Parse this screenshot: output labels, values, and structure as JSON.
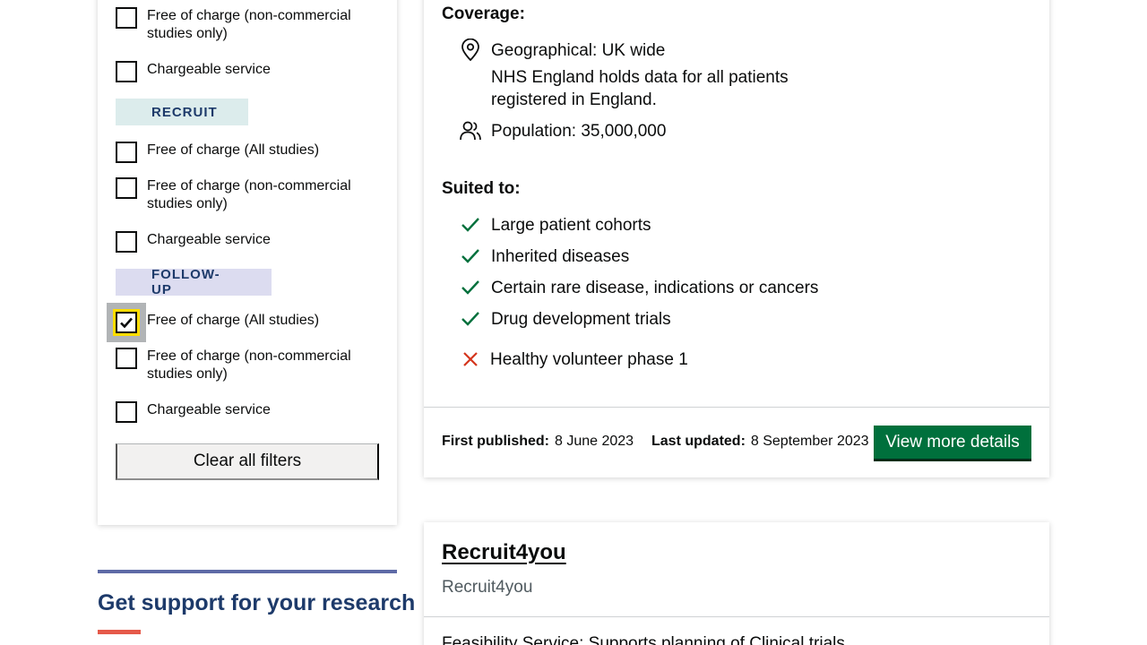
{
  "filters": {
    "top_items": [
      {
        "label": "Free of charge (non-commercial studies only)",
        "checked": false
      },
      {
        "label": "Chargeable service",
        "checked": false
      }
    ],
    "recruit": {
      "tag": "RECRUIT",
      "items": [
        {
          "label": "Free of charge (All studies)",
          "checked": false
        },
        {
          "label": "Free of charge (non-commercial studies only)",
          "checked": false
        },
        {
          "label": "Chargeable service",
          "checked": false
        }
      ]
    },
    "follow_up": {
      "tag": "FOLLOW-UP",
      "items": [
        {
          "label": "Free of charge (All studies)",
          "checked": true
        },
        {
          "label": "Free of charge (non-commercial studies only)",
          "checked": false
        },
        {
          "label": "Chargeable service",
          "checked": false
        }
      ]
    },
    "clear_label": "Clear all filters"
  },
  "support": {
    "title": "Get support for your research"
  },
  "card": {
    "coverage_heading": "Coverage:",
    "geographical": "Geographical: UK wide",
    "geo_note": "NHS England holds data for all patients registered in England.",
    "population": "Population: 35,000,000",
    "suited_heading": "Suited to:",
    "suited": [
      "Large patient cohorts",
      "Inherited diseases",
      "Certain rare disease, indications or cancers",
      "Drug development trials"
    ],
    "not_suited": [
      "Healthy volunteer phase 1"
    ],
    "first_published_label": "First published:",
    "first_published": "8 June 2023",
    "last_updated_label": "Last updated:",
    "last_updated": "8 September 2023",
    "view_button": "View more details"
  },
  "card2": {
    "title": "Recruit4you",
    "subtitle": "Recruit4you",
    "description": "Feasibility Service: Supports planning of Clinical trials"
  },
  "colors": {
    "tick": "#00703c",
    "cross": "#d4351c",
    "button": "#00703c",
    "heading_blue": "#1d3a6a",
    "focus": "#ffdd00"
  },
  "icons": {
    "location": "map-pin-icon",
    "population": "users-icon",
    "tick": "check-icon",
    "cross": "cross-icon"
  }
}
